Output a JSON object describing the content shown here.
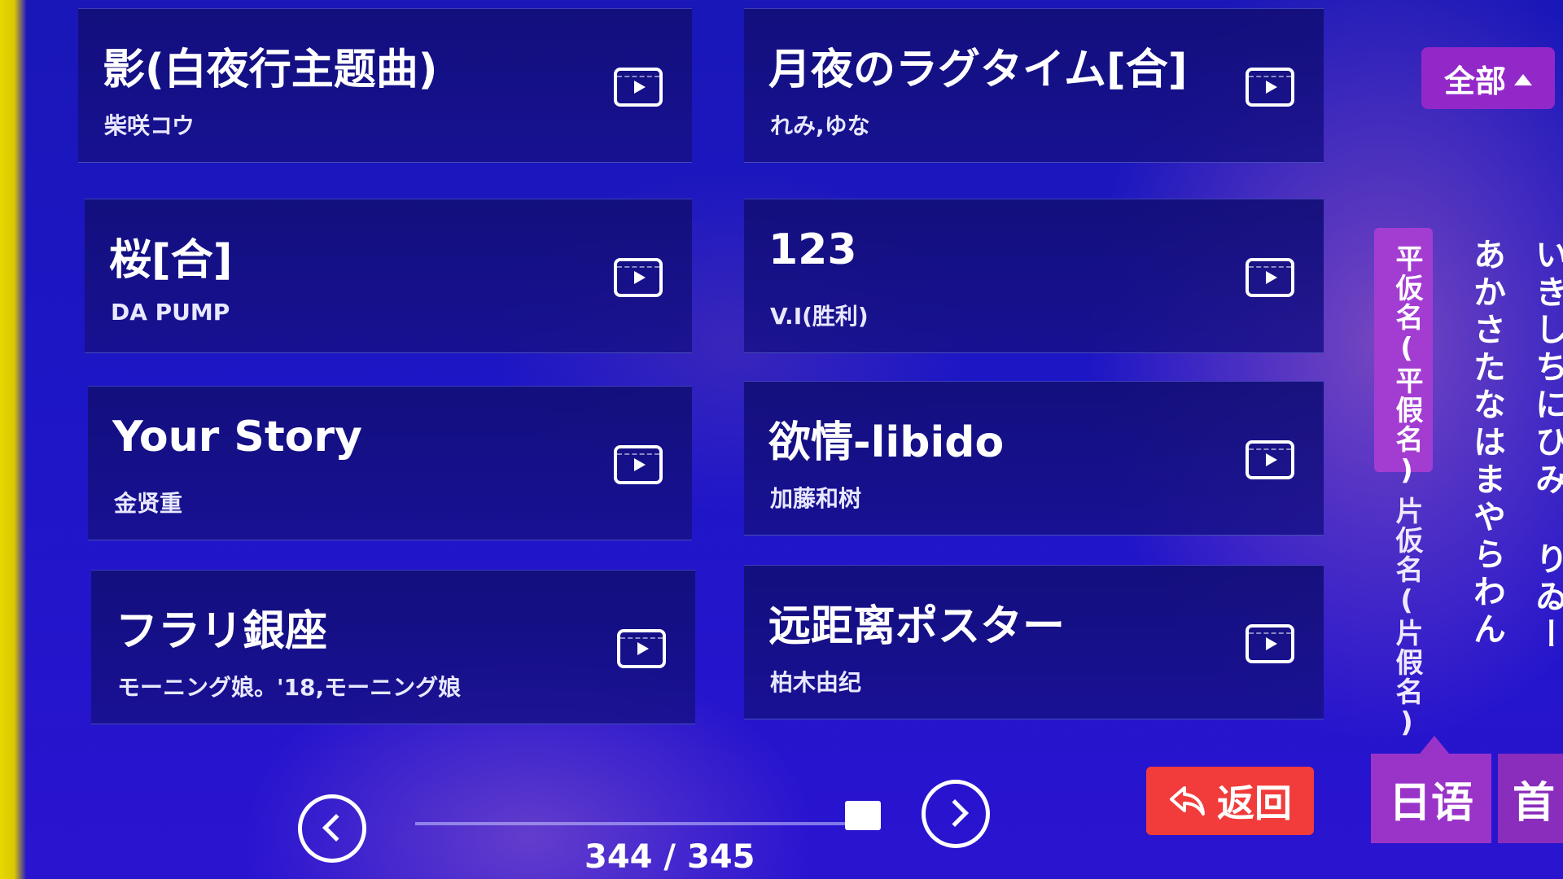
{
  "songs": [
    {
      "title": "影(白夜行主题曲)",
      "artist": "柴咲コウ"
    },
    {
      "title": "月夜のラグタイム[合]",
      "artist": "れみ,ゆな"
    },
    {
      "title": "桜[合]",
      "artist": "DA PUMP"
    },
    {
      "title": "123",
      "artist": "V.I(胜利)"
    },
    {
      "title": "Your Story",
      "artist": "金贤重"
    },
    {
      "title": "欲情-libido",
      "artist": "加藤和树"
    },
    {
      "title": "フラリ銀座",
      "artist": "モーニング娘。'18,モーニング娘"
    },
    {
      "title": "远距离ポスター",
      "artist": "柏木由纪"
    }
  ],
  "filter": {
    "all_label": "全部"
  },
  "kana": {
    "hiragana_tab": "平仮名(平假名)",
    "katakana_tab": "片仮名(片假名)",
    "column1": "あかさたなはまやらわん",
    "column2": "いきしちにひみ りゐー"
  },
  "pagination": {
    "current": 344,
    "total": 345,
    "label": "344 / 345",
    "position_fraction": 0.997
  },
  "buttons": {
    "back_label": "返回",
    "language_label": "日语",
    "home_label": "首"
  },
  "icons": {
    "play": "play-video-icon",
    "prev": "chevron-left-icon",
    "next": "chevron-right-icon",
    "back": "return-arrow-icon"
  },
  "colors": {
    "background": "#1d16c6",
    "accent_purple": "#9a34c8",
    "back_red": "#f23b3b"
  }
}
